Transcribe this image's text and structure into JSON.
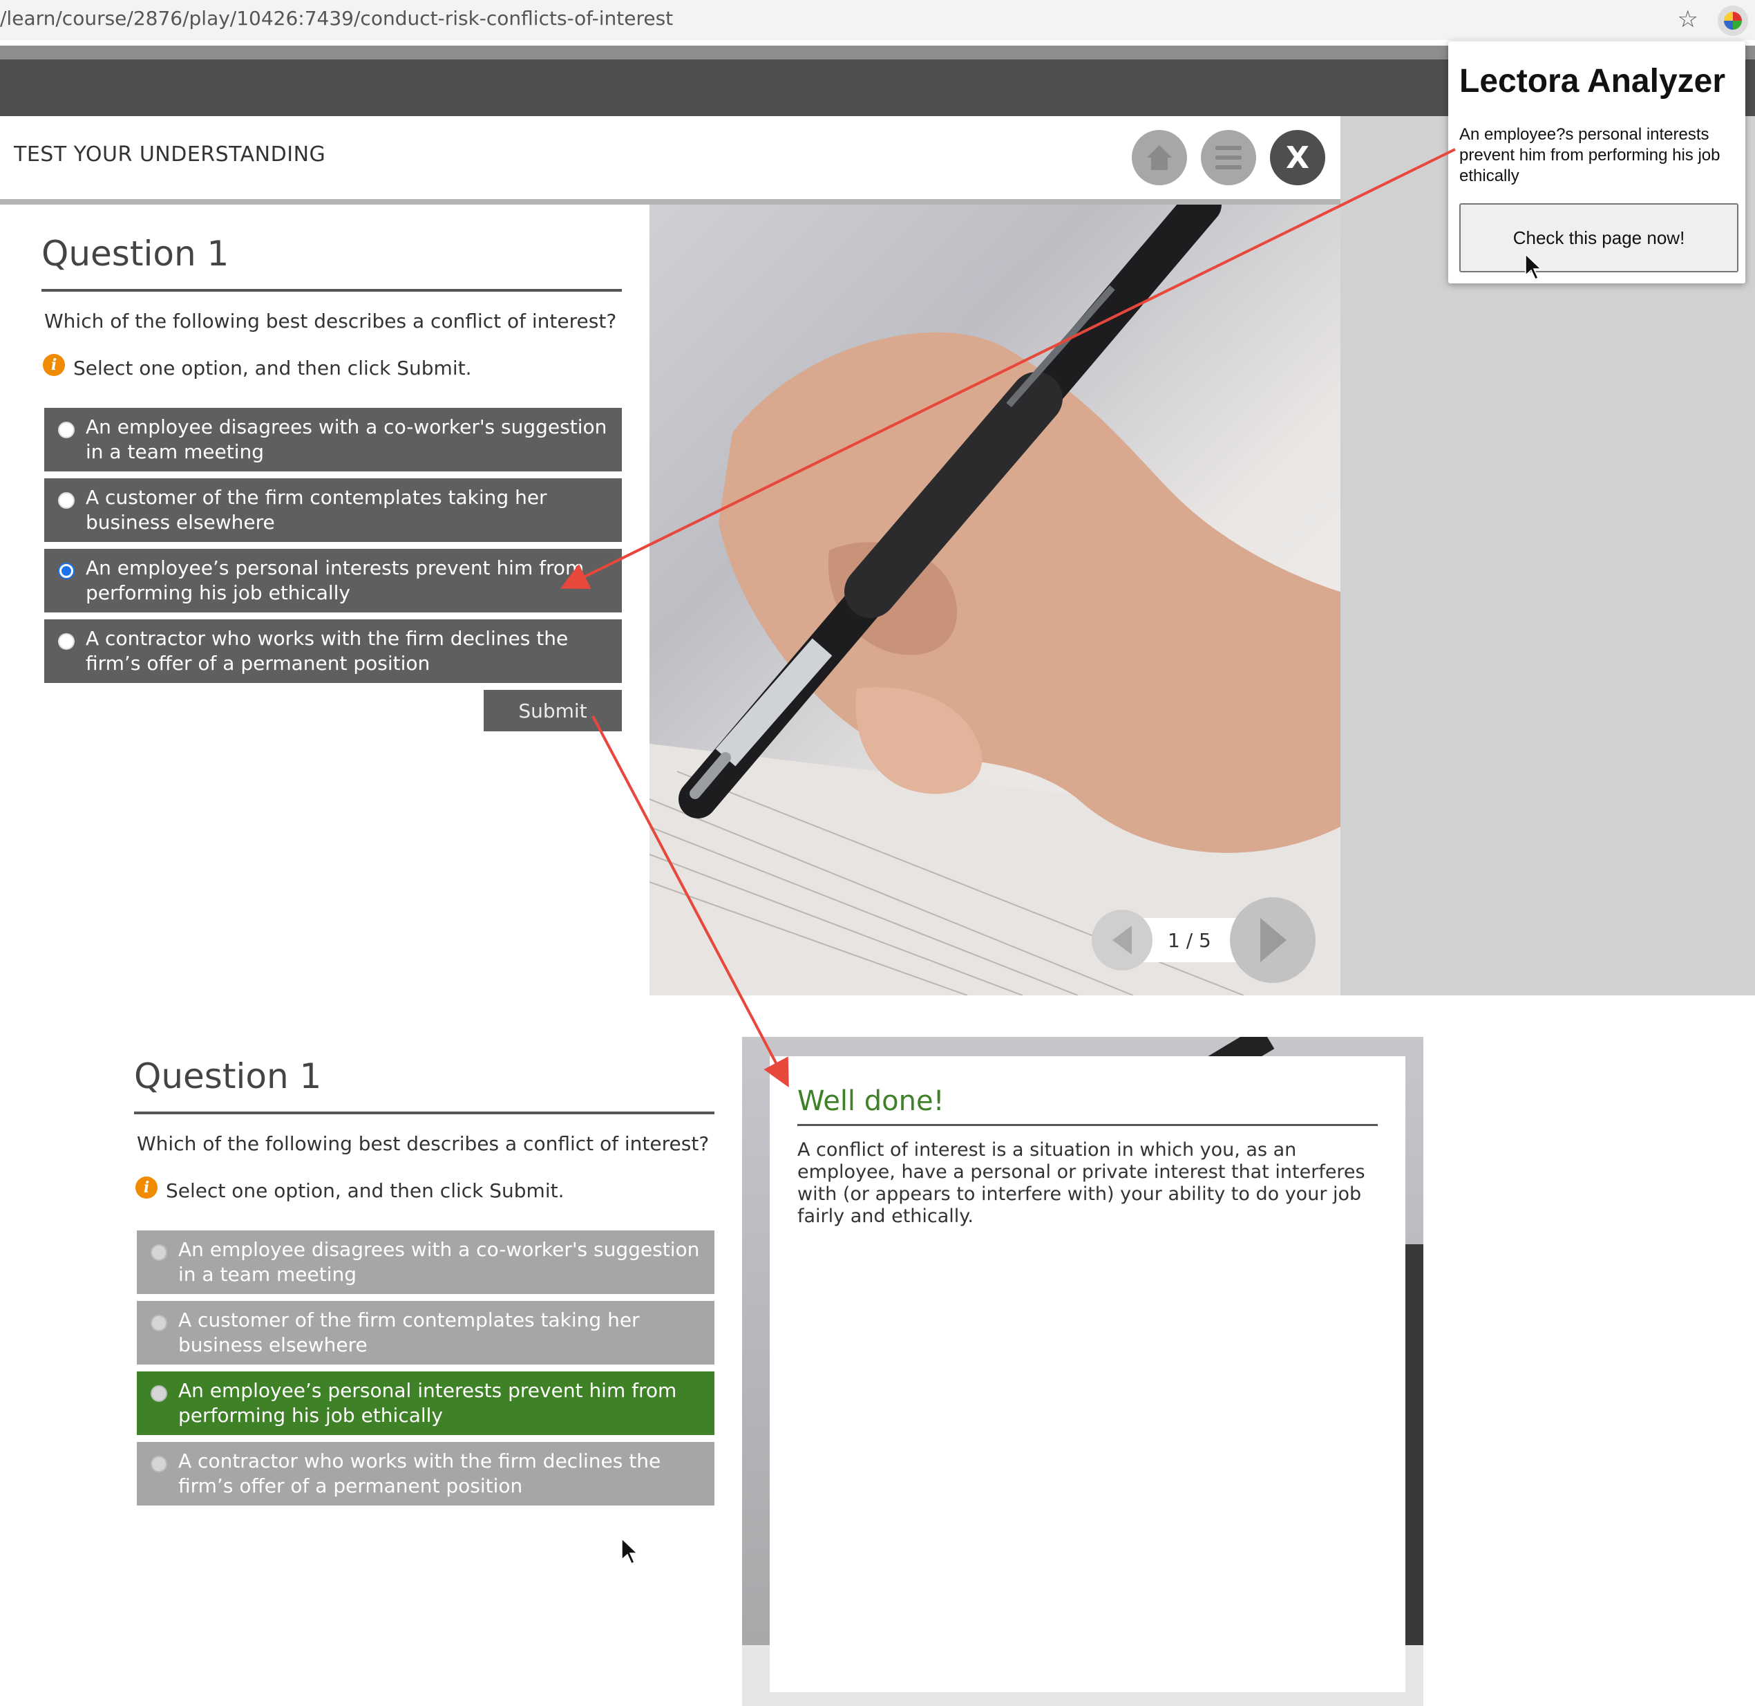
{
  "browser": {
    "url": "/learn/course/2876/play/10426:7439/conduct-risk-conflicts-of-interest",
    "star_icon": "star-icon",
    "extension_icon": "lectora-extension-icon"
  },
  "course": {
    "header_title": "TEST YOUR UNDERSTANDING",
    "close_label": "X",
    "page_indicator": "1 / 5"
  },
  "question": {
    "title": "Question 1",
    "prompt": "Which of the following best describes a conflict of interest?",
    "instruction": "Select one option, and then click Submit.",
    "info_icon_glyph": "i",
    "options": [
      {
        "label": "An employee disagrees with a co-worker's suggestion in a team meeting"
      },
      {
        "label": "A customer of the firm contemplates taking her business elsewhere"
      },
      {
        "label": "An employee’s personal interests prevent him from performing his job ethically"
      },
      {
        "label": "A contractor who works with the firm declines the firm’s offer of a permanent position"
      }
    ],
    "selected_index": 2,
    "submit_label": "Submit"
  },
  "analyzer": {
    "title": "Lectora Analyzer",
    "text": "An employee?s personal interests prevent him from performing his job ethically",
    "button_label": "Check this page now!"
  },
  "result": {
    "question_title": "Question 1",
    "prompt": "Which of the following best describes a conflict of interest?",
    "instruction": "Select one option, and then click Submit.",
    "options": [
      {
        "label": "An employee disagrees with a co-worker's suggestion in a team meeting",
        "state": "disabled"
      },
      {
        "label": "A customer of the firm contemplates taking her business elsewhere",
        "state": "disabled"
      },
      {
        "label": "An employee’s personal interests prevent him from performing his job ethically",
        "state": "correct"
      },
      {
        "label": "A contractor who works with the firm declines the firm’s offer of a permanent position",
        "state": "disabled"
      }
    ],
    "feedback_title": "Well done!",
    "feedback_text": "A conflict of interest is a situation in which you, as an employee, have a personal or private interest that interferes with (or appears to interfere with) your ability to do your job fairly and ethically."
  },
  "colors": {
    "correct_green": "#3e8126",
    "option_gray": "#5f5f5f",
    "option_disabled": "#a6a6a6",
    "annotation_arrow": "#e8473b",
    "info_orange": "#f08a00"
  }
}
